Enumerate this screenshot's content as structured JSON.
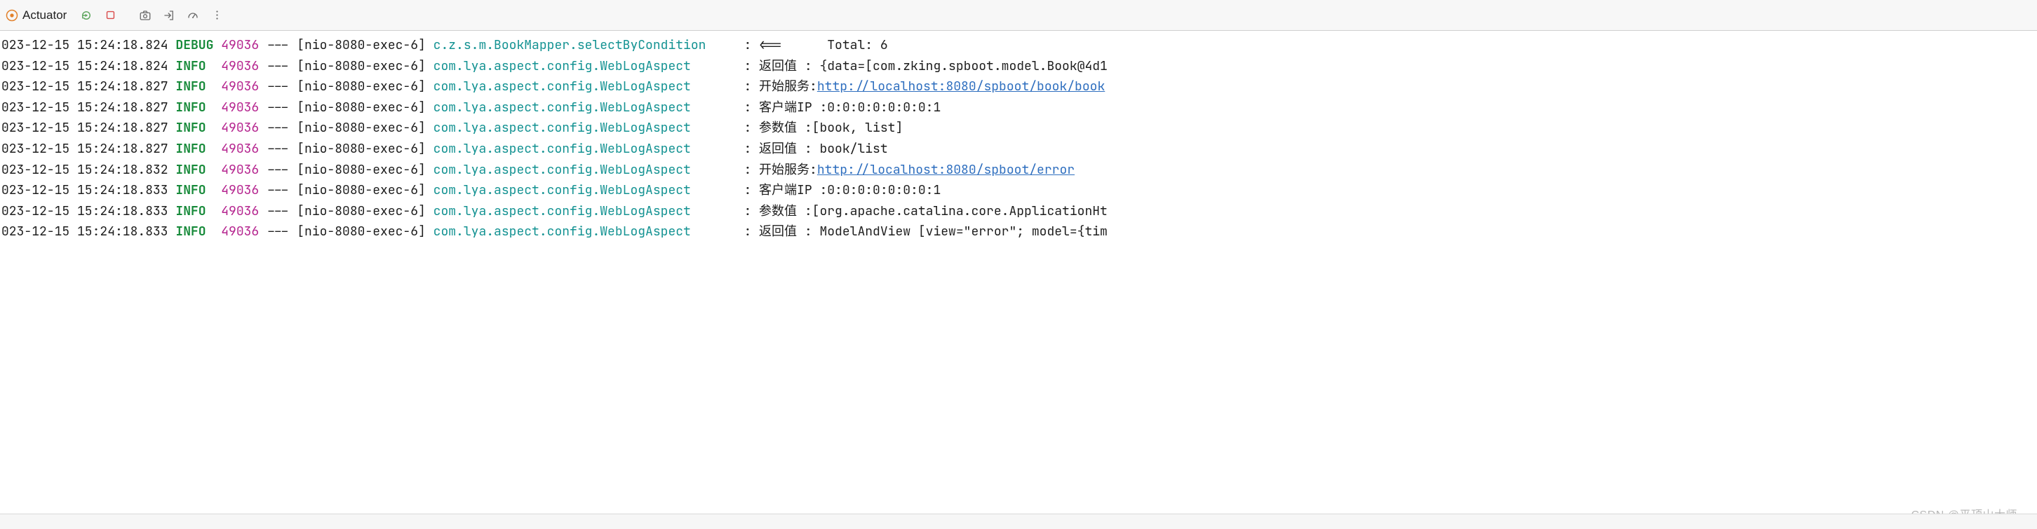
{
  "toolbar": {
    "title": "Actuator"
  },
  "colors": {
    "level": "#178a3a",
    "pid": "#b5258f",
    "logger": "#159393",
    "link": "#2f6fbf"
  },
  "log": {
    "lines": [
      {
        "ts": "023-12-15 15:24:18.824",
        "level": "DEBUG",
        "pid": "49036",
        "sep": "---",
        "thread": "[nio-8080-exec-6]",
        "logger": "c.z.s.m.BookMapper.selectByCondition",
        "msg_prefix": ": <==      Total: 6",
        "link": "",
        "msg_suffix": ""
      },
      {
        "ts": "023-12-15 15:24:18.824",
        "level": "INFO",
        "pid": "49036",
        "sep": "---",
        "thread": "[nio-8080-exec-6]",
        "logger": "com.lya.aspect.config.WebLogAspect",
        "msg_prefix": ": 返回值 : {data=[com.zking.spboot.model.Book@4d1",
        "link": "",
        "msg_suffix": ""
      },
      {
        "ts": "023-12-15 15:24:18.827",
        "level": "INFO",
        "pid": "49036",
        "sep": "---",
        "thread": "[nio-8080-exec-6]",
        "logger": "com.lya.aspect.config.WebLogAspect",
        "msg_prefix": ": 开始服务:",
        "link": "http://localhost:8080/spboot/book/book",
        "msg_suffix": ""
      },
      {
        "ts": "023-12-15 15:24:18.827",
        "level": "INFO",
        "pid": "49036",
        "sep": "---",
        "thread": "[nio-8080-exec-6]",
        "logger": "com.lya.aspect.config.WebLogAspect",
        "msg_prefix": ": 客户端IP :0:0:0:0:0:0:0:1",
        "link": "",
        "msg_suffix": ""
      },
      {
        "ts": "023-12-15 15:24:18.827",
        "level": "INFO",
        "pid": "49036",
        "sep": "---",
        "thread": "[nio-8080-exec-6]",
        "logger": "com.lya.aspect.config.WebLogAspect",
        "msg_prefix": ": 参数值 :[book, list]",
        "link": "",
        "msg_suffix": ""
      },
      {
        "ts": "023-12-15 15:24:18.827",
        "level": "INFO",
        "pid": "49036",
        "sep": "---",
        "thread": "[nio-8080-exec-6]",
        "logger": "com.lya.aspect.config.WebLogAspect",
        "msg_prefix": ": 返回值 : book/list",
        "link": "",
        "msg_suffix": ""
      },
      {
        "ts": "023-12-15 15:24:18.832",
        "level": "INFO",
        "pid": "49036",
        "sep": "---",
        "thread": "[nio-8080-exec-6]",
        "logger": "com.lya.aspect.config.WebLogAspect",
        "msg_prefix": ": 开始服务:",
        "link": "http://localhost:8080/spboot/error",
        "msg_suffix": ""
      },
      {
        "ts": "023-12-15 15:24:18.833",
        "level": "INFO",
        "pid": "49036",
        "sep": "---",
        "thread": "[nio-8080-exec-6]",
        "logger": "com.lya.aspect.config.WebLogAspect",
        "msg_prefix": ": 客户端IP :0:0:0:0:0:0:0:1",
        "link": "",
        "msg_suffix": ""
      },
      {
        "ts": "023-12-15 15:24:18.833",
        "level": "INFO",
        "pid": "49036",
        "sep": "---",
        "thread": "[nio-8080-exec-6]",
        "logger": "com.lya.aspect.config.WebLogAspect",
        "msg_prefix": ": 参数值 :[org.apache.catalina.core.ApplicationHt",
        "link": "",
        "msg_suffix": ""
      },
      {
        "ts": "023-12-15 15:24:18.833",
        "level": "INFO",
        "pid": "49036",
        "sep": "---",
        "thread": "[nio-8080-exec-6]",
        "logger": "com.lya.aspect.config.WebLogAspect",
        "msg_prefix": ": 返回值 : ModelAndView [view=\"error\"; model={tim",
        "link": "",
        "msg_suffix": ""
      }
    ]
  },
  "watermark": "CSDN @平顶山大师"
}
